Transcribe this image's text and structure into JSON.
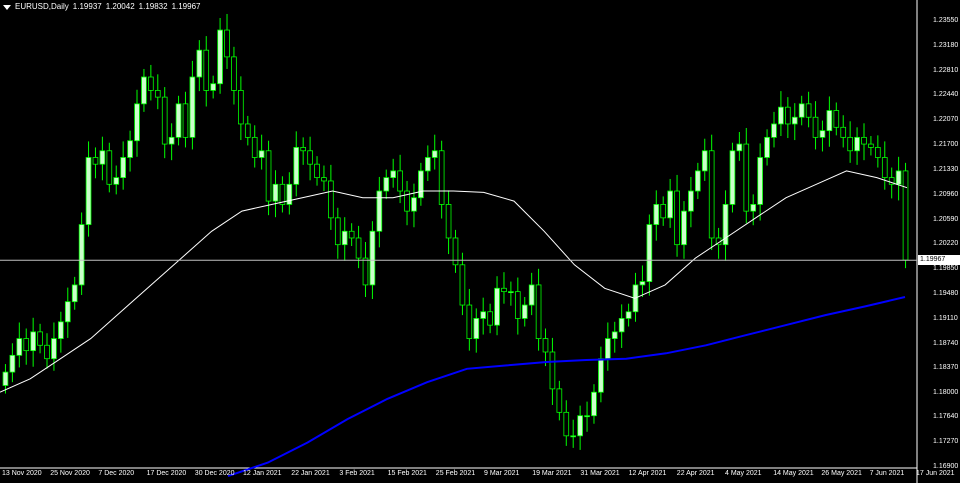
{
  "header": {
    "symbol": "EURUSD",
    "timeframe": "Daily",
    "title": "EURUSD,Daily",
    "open": "1.19937",
    "high": "1.20042",
    "low": "1.19832",
    "close": "1.19967"
  },
  "current_price_label": "1.19967",
  "colors": {
    "background": "#000000",
    "bull_candle": "#00ff00",
    "bull_body": "#ccffcc",
    "bear_candle": "#00ff00",
    "bear_body": "#000000",
    "ma_fast": "#ffffff",
    "ma_slow": "#0000ff",
    "price_line": "#c0c0c0",
    "axis_text": "#ffffff"
  },
  "icons": [
    "dropdown-triangle-icon"
  ],
  "chart_data": {
    "type": "candlestick",
    "title": "EURUSD,Daily",
    "ylim": [
      1.169,
      1.2366
    ],
    "y_ticks": [
      "1.23550",
      "1.23180",
      "1.22810",
      "1.22440",
      "1.22070",
      "1.21700",
      "1.21330",
      "1.20960",
      "1.20590",
      "1.20220",
      "1.19850",
      "1.19480",
      "1.19110",
      "1.18740",
      "1.18370",
      "1.18000",
      "1.17640",
      "1.17270",
      "1.16900"
    ],
    "x_ticks": [
      "13 Nov 2020",
      "25 Nov 2020",
      "7 Dec 2020",
      "17 Dec 2020",
      "30 Dec 2020",
      "12 Jan 2021",
      "22 Jan 2021",
      "3 Feb 2021",
      "15 Feb 2021",
      "25 Feb 2021",
      "9 Mar 2021",
      "19 Mar 2021",
      "31 Mar 2021",
      "12 Apr 2021",
      "22 Apr 2021",
      "4 May 2021",
      "14 May 2021",
      "26 May 2021",
      "7 Jun 2021",
      "17 Jun 2021"
    ],
    "current_price": 1.19967,
    "closes": [
      1.183,
      1.1855,
      1.188,
      1.1862,
      1.189,
      1.187,
      1.185,
      1.188,
      1.1905,
      1.1935,
      1.196,
      1.205,
      1.215,
      1.214,
      1.216,
      1.211,
      1.212,
      1.215,
      1.2175,
      1.223,
      1.227,
      1.225,
      1.224,
      1.217,
      1.218,
      1.223,
      1.218,
      1.227,
      1.231,
      1.225,
      1.226,
      1.234,
      1.23,
      1.225,
      1.22,
      1.218,
      1.215,
      1.216,
      1.2085,
      1.211,
      1.208,
      1.211,
      1.2165,
      1.216,
      1.214,
      1.212,
      1.2115,
      1.206,
      1.202,
      1.204,
      1.203,
      1.2,
      1.196,
      1.204,
      1.21,
      1.212,
      1.213,
      1.21,
      1.207,
      1.209,
      1.213,
      1.215,
      1.216,
      1.208,
      1.203,
      1.199,
      1.193,
      1.188,
      1.191,
      1.192,
      1.19,
      1.1955,
      1.195,
      1.195,
      1.191,
      1.193,
      1.196,
      1.188,
      1.186,
      1.1805,
      1.177,
      1.1735,
      1.1735,
      1.1765,
      1.1765,
      1.18,
      1.185,
      1.188,
      1.189,
      1.191,
      1.192,
      1.196,
      1.1965,
      1.205,
      1.208,
      1.206,
      1.21,
      1.202,
      1.207,
      1.21,
      1.213,
      1.216,
      1.203,
      1.202,
      1.208,
      1.216,
      1.217,
      1.207,
      1.208,
      1.215,
      1.218,
      1.22,
      1.2225,
      1.22,
      1.221,
      1.223,
      1.221,
      1.218,
      1.219,
      1.222,
      1.2195,
      1.218,
      1.216,
      1.218,
      1.217,
      1.2165,
      1.215,
      1.212,
      1.211,
      1.213,
      1.1997
    ],
    "series": [
      {
        "name": "",
        "type": "ma",
        "color": "#ffffff",
        "values": [
          1.18,
          1.182,
          1.185,
          1.188,
          1.192,
          1.196,
          1.2,
          1.204,
          1.207,
          1.208,
          1.209,
          1.21,
          1.209,
          1.209,
          1.21,
          1.21,
          1.2098,
          1.2085,
          1.204,
          1.199,
          1.1955,
          1.194,
          1.196,
          1.2,
          1.203,
          1.206,
          1.209,
          1.211,
          1.213,
          1.212,
          1.2105
        ]
      },
      {
        "name": "",
        "type": "ma",
        "color": "#0000ff",
        "values": [
          1.1675,
          1.1695,
          1.1725,
          1.176,
          1.179,
          1.1815,
          1.1835,
          1.184,
          1.1845,
          1.1848,
          1.185,
          1.1858,
          1.187,
          1.1885,
          1.19,
          1.1915,
          1.1928,
          1.1942
        ]
      }
    ]
  }
}
